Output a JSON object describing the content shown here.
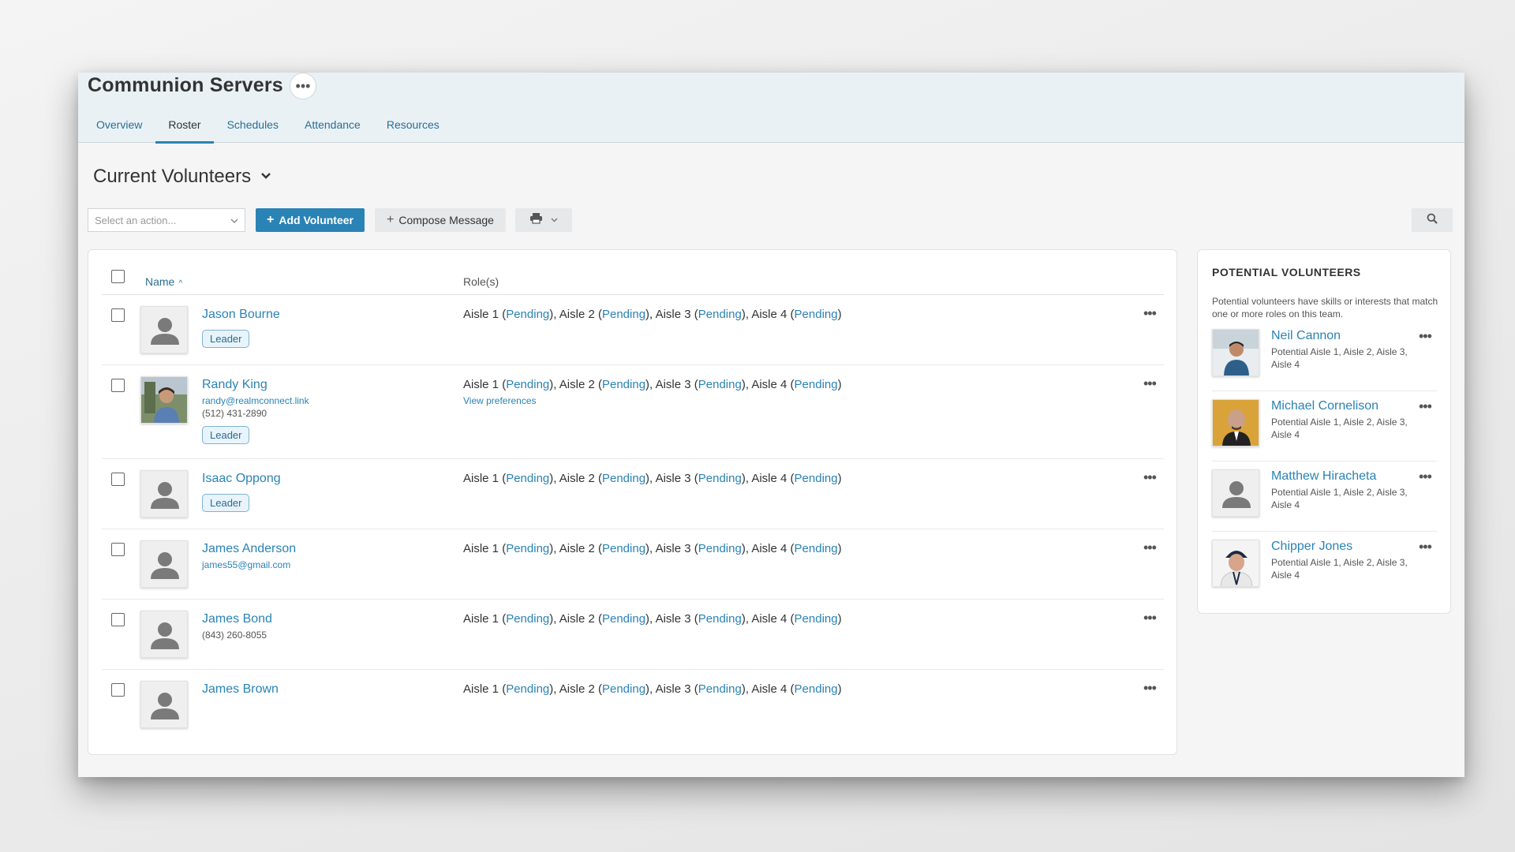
{
  "header": {
    "title": "Communion Servers",
    "more_label": "•••"
  },
  "tabs": [
    {
      "label": "Overview"
    },
    {
      "label": "Roster",
      "active": true
    },
    {
      "label": "Schedules"
    },
    {
      "label": "Attendance"
    },
    {
      "label": "Resources"
    }
  ],
  "section": {
    "title": "Current Volunteers",
    "chevron": "⌄"
  },
  "toolbar": {
    "select_placeholder": "Select an action...",
    "add_label": "Add Volunteer",
    "compose_label": "Compose Message"
  },
  "table": {
    "col_name": "Name",
    "col_roles": "Role(s)"
  },
  "volunteers": [
    {
      "name": "Jason Bourne",
      "badge": "Leader",
      "roles": [
        {
          "role": "Aisle 1",
          "status": "Pending"
        },
        {
          "role": "Aisle 2",
          "status": "Pending"
        },
        {
          "role": "Aisle 3",
          "status": "Pending"
        },
        {
          "role": "Aisle 4",
          "status": "Pending"
        }
      ]
    },
    {
      "name": "Randy King",
      "email": "randy@realmconnect.link",
      "phone": "(512) 431-2890",
      "badge": "Leader",
      "view_prefs": "View preferences",
      "roles": [
        {
          "role": "Aisle 1",
          "status": "Pending"
        },
        {
          "role": "Aisle 2",
          "status": "Pending"
        },
        {
          "role": "Aisle 3",
          "status": "Pending"
        },
        {
          "role": "Aisle 4",
          "status": "Pending"
        }
      ]
    },
    {
      "name": "Isaac Oppong",
      "badge": "Leader",
      "roles": [
        {
          "role": "Aisle 1",
          "status": "Pending"
        },
        {
          "role": "Aisle 2",
          "status": "Pending"
        },
        {
          "role": "Aisle 3",
          "status": "Pending"
        },
        {
          "role": "Aisle 4",
          "status": "Pending"
        }
      ]
    },
    {
      "name": "James Anderson",
      "email": "james55@gmail.com",
      "roles": [
        {
          "role": "Aisle 1",
          "status": "Pending"
        },
        {
          "role": "Aisle 2",
          "status": "Pending"
        },
        {
          "role": "Aisle 3",
          "status": "Pending"
        },
        {
          "role": "Aisle 4",
          "status": "Pending"
        }
      ]
    },
    {
      "name": "James Bond",
      "phone": "(843) 260-8055",
      "roles": [
        {
          "role": "Aisle 1",
          "status": "Pending"
        },
        {
          "role": "Aisle 2",
          "status": "Pending"
        },
        {
          "role": "Aisle 3",
          "status": "Pending"
        },
        {
          "role": "Aisle 4",
          "status": "Pending"
        }
      ]
    },
    {
      "name": "James Brown",
      "roles": [
        {
          "role": "Aisle 1",
          "status": "Pending"
        },
        {
          "role": "Aisle 2",
          "status": "Pending"
        },
        {
          "role": "Aisle 3",
          "status": "Pending"
        },
        {
          "role": "Aisle 4",
          "status": "Pending"
        }
      ]
    }
  ],
  "potential": {
    "title": "POTENTIAL VOLUNTEERS",
    "description": "Potential volunteers have skills or interests that match one or more roles on this team.",
    "people": [
      {
        "name": "Neil Cannon",
        "detail": "Potential Aisle 1, Aisle 2, Aisle 3, Aisle 4"
      },
      {
        "name": "Michael Cornelison",
        "detail": "Potential Aisle 1, Aisle 2, Aisle 3, Aisle 4"
      },
      {
        "name": "Matthew Hiracheta",
        "detail": "Potential Aisle 1, Aisle 2, Aisle 3, Aisle 4"
      },
      {
        "name": "Chipper Jones",
        "detail": "Potential Aisle 1, Aisle 2, Aisle 3, Aisle 4"
      }
    ]
  },
  "colors": {
    "accent": "#2a83b5",
    "link": "#2a6f94",
    "topbar_bg": "#e9f1f5"
  }
}
